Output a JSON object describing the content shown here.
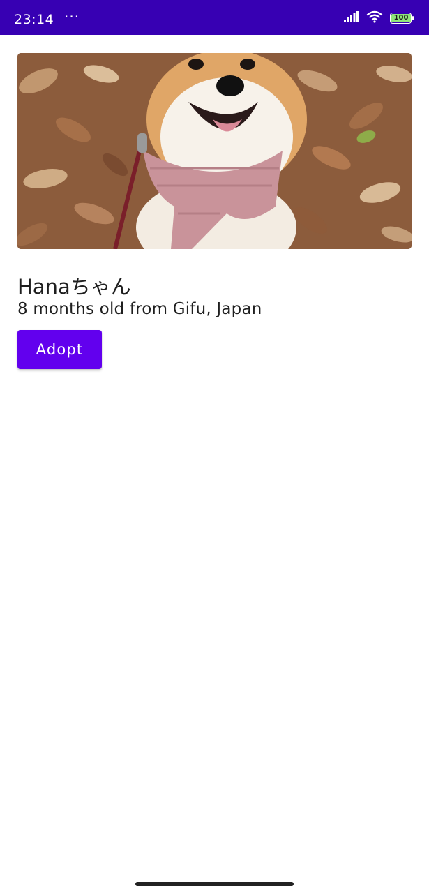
{
  "status_bar": {
    "time": "23:14",
    "more": "···",
    "battery_level": "100",
    "background_color": "#3700b3",
    "icons": [
      "signal-icon",
      "wifi-icon",
      "battery-icon"
    ]
  },
  "pet": {
    "photo_subject": "Shiba Inu dog wearing pink knitted scarf on autumn leaves",
    "name": "Hanaちゃん",
    "details": "8 months old from Gifu, Japan",
    "adopt_label": "Adopt"
  },
  "colors": {
    "primary": "#6200ee",
    "primary_dark": "#3700b3",
    "text": "#1f1f1f"
  }
}
